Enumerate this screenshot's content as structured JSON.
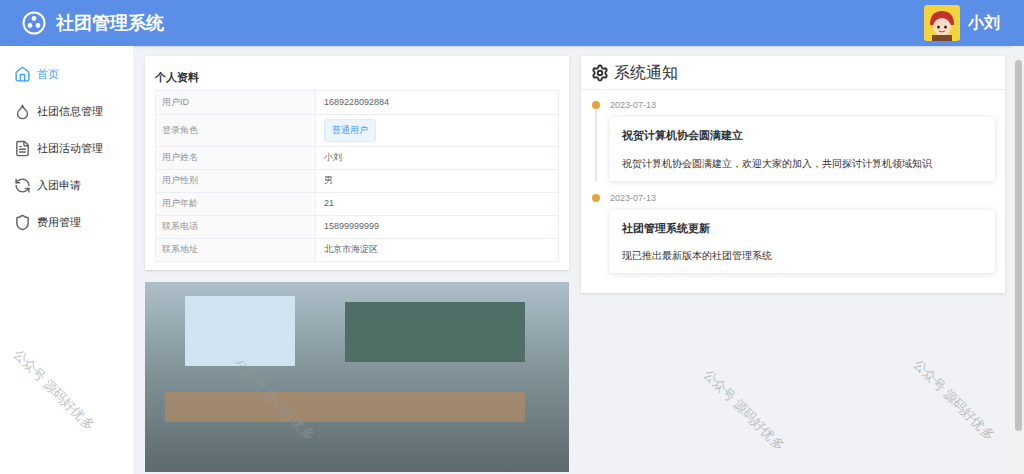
{
  "header": {
    "title": "社团管理系统",
    "user": "小刘"
  },
  "sidebar": {
    "items": [
      {
        "label": "首页",
        "selected": true
      },
      {
        "label": "社团信息管理",
        "selected": false
      },
      {
        "label": "社团活动管理",
        "selected": false
      },
      {
        "label": "入团申请",
        "selected": false
      },
      {
        "label": "费用管理",
        "selected": false
      }
    ]
  },
  "profile": {
    "title": "个人资料",
    "rows": [
      {
        "label": "用户ID",
        "value": "1689228092884",
        "kind": "text"
      },
      {
        "label": "登录角色",
        "value": "普通用户",
        "kind": "badge"
      },
      {
        "label": "用户姓名",
        "value": "小刘",
        "kind": "text"
      },
      {
        "label": "用户性别",
        "value": "男",
        "kind": "text"
      },
      {
        "label": "用户年龄",
        "value": "21",
        "kind": "text"
      },
      {
        "label": "联系电话",
        "value": "15899999999",
        "kind": "text"
      },
      {
        "label": "联系地址",
        "value": "北京市海淀区",
        "kind": "text"
      }
    ]
  },
  "notices": {
    "title": "系统通知",
    "items": [
      {
        "date": "2023-07-13",
        "title": "祝贺计算机协会圆满建立",
        "content": "祝贺计算机协会圆满建立，欢迎大家的加入，共同探讨计算机领域知识"
      },
      {
        "date": "2023-07-13",
        "title": "社团管理系统更新",
        "content": "现已推出最新版本的社团管理系统"
      }
    ]
  },
  "scrollbar": {
    "level": 0.9
  },
  "watermark": "公众号 源码好优多"
}
